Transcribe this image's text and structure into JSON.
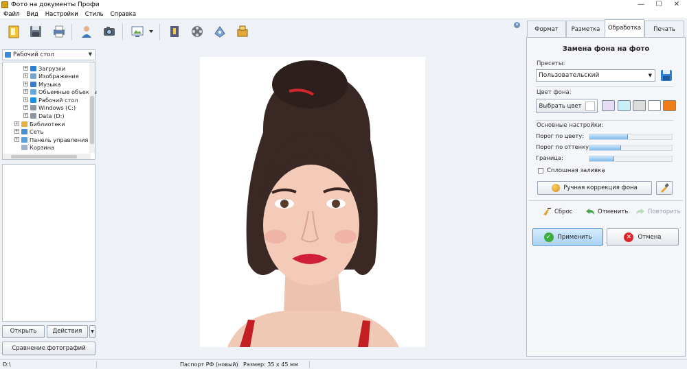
{
  "window": {
    "title": "Фото на документы Профи"
  },
  "menu": [
    "Файл",
    "Вид",
    "Настройки",
    "Стиль",
    "Справка"
  ],
  "toolbar": {
    "icons": [
      "open-folder-icon",
      "save-icon",
      "print-icon",
      "user-icon",
      "camera-icon",
      "image-view-icon",
      "book-icon",
      "film-icon",
      "tools-icon",
      "puzzle-icon"
    ]
  },
  "left": {
    "folder_combo": "Рабочий стол",
    "tree": [
      {
        "label": "Загрузки",
        "icon": "download-icon"
      },
      {
        "label": "Изображения",
        "icon": "images-icon"
      },
      {
        "label": "Музыка",
        "icon": "music-icon"
      },
      {
        "label": "Объемные объекты",
        "icon": "3d-objects-icon"
      },
      {
        "label": "Рабочий стол",
        "icon": "desktop-icon"
      },
      {
        "label": "Windows (C:)",
        "icon": "drive-icon"
      },
      {
        "label": "Data (D:)",
        "icon": "drive-icon"
      },
      {
        "label": "Библиотеки",
        "icon": "library-icon"
      },
      {
        "label": "Сеть",
        "icon": "network-icon"
      },
      {
        "label": "Панель управления",
        "icon": "control-panel-icon"
      },
      {
        "label": "Корзина",
        "icon": "trash-icon"
      }
    ],
    "open_btn": "Открыть",
    "actions_btn": "Действия",
    "compare_btn": "Сравнение фотографий"
  },
  "tabs": [
    "Формат",
    "Разметка",
    "Обработка",
    "Печать"
  ],
  "panel": {
    "title": "Замена фона на фото",
    "presets_label": "Пресеты:",
    "preset_value": "Пользовательский",
    "bgcolor_label": "Цвет фона:",
    "pick_color_btn": "Выбрать цвет",
    "swatches": [
      "#e6dcf5",
      "#c9eef7",
      "#dcdcdc",
      "#ffffff",
      "#f07d18"
    ],
    "main_settings_label": "Основные настройки:",
    "sliders": [
      {
        "label": "Порог по цвету:",
        "value": 0.47
      },
      {
        "label": "Порог по оттенку:",
        "value": 0.38
      },
      {
        "label": "Граница:",
        "value": 0.3
      }
    ],
    "solid_fill_label": "Сплошная заливка",
    "solid_fill_checked": false,
    "manual_btn": "Ручная коррекция фона",
    "reset_label": "Сброс",
    "undo_label": "Отменить",
    "redo_label": "Повторить",
    "apply_btn": "Применить",
    "cancel_btn": "Отмена"
  },
  "status": {
    "path": "D:\\",
    "format": "Паспорт РФ (новый)",
    "size": "Размер: 35 х 45 мм"
  },
  "colors": {
    "accent_blue": "#bfe0fb",
    "panel_bg": "#eef2f6"
  }
}
